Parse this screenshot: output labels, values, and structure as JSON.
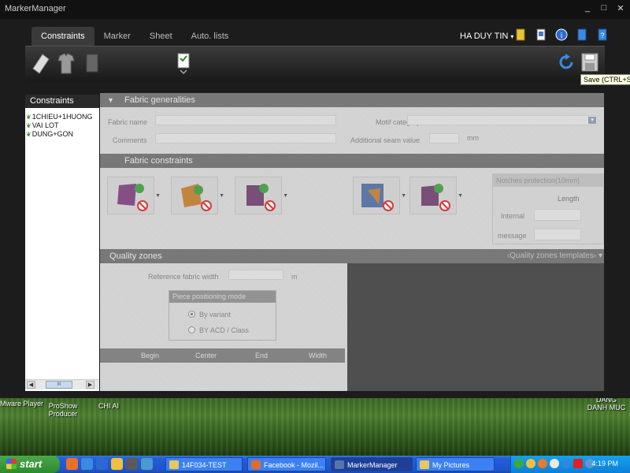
{
  "window": {
    "title": "MarkerManager",
    "controls": [
      "_",
      "□",
      "✕"
    ]
  },
  "tabs": [
    {
      "label": "Constraints",
      "active": true
    },
    {
      "label": "Marker",
      "active": false
    },
    {
      "label": "Sheet",
      "active": false
    },
    {
      "label": "Auto. lists",
      "active": false
    }
  ],
  "user": {
    "name": "HA DUY TIN",
    "caret": "▾"
  },
  "tooltip": "Save (CTRL+S)",
  "sidebar": {
    "header": "Constraints",
    "items": [
      "1CHIEU+1HUONG",
      "VAI LOT",
      "DUNG+GON"
    ],
    "scroll_thumb": "III"
  },
  "fabric_generalities": {
    "header": "Fabric generalities",
    "fabric_name_label": "Fabric name",
    "comments_label": "Comments",
    "motif_category_label": "Motif category",
    "additional_seam_label": "Additional seam value",
    "unit": "mm"
  },
  "fabric_constraints": {
    "header": "Fabric constraints",
    "notches": {
      "header": "Notches protection(10mm)",
      "length_label": "Length",
      "internal_label": "Internal",
      "message_label": "message"
    }
  },
  "quality_zones": {
    "header": "Quality zones",
    "templates_label": "‹Quality zones templates› ▾",
    "ref_width_label": "Reference fabric width",
    "ref_width_unit": "m",
    "piece_mode": {
      "header": "Piece positioning mode",
      "option1": "By variant",
      "option2": "BY ACD / Class",
      "selected": 1
    },
    "columns": [
      "Begin",
      "Center",
      "End",
      "Width"
    ]
  },
  "desktop_labels": {
    "vmware": "Mware Player",
    "proshow": "ProShow Producer",
    "chiai": "CHI AI",
    "corner": "DANG DANH MUC"
  },
  "taskbar": {
    "start": "start",
    "buttons": [
      {
        "label": "14F034-TEST",
        "active": false,
        "color": "#e8c85a"
      },
      {
        "label": "Facebook - Mozil...",
        "active": false,
        "color": "#e86a2a"
      },
      {
        "label": "MarkerManager",
        "active": true,
        "color": "#5577aa"
      },
      {
        "label": "My Pictures",
        "active": false,
        "color": "#e8c85a"
      }
    ],
    "clock": "4:19 PM"
  },
  "colors": {
    "accent_green": "#2a8a2a",
    "app_bg": "#1c1c1c",
    "section_header": "#6a6a6a"
  }
}
